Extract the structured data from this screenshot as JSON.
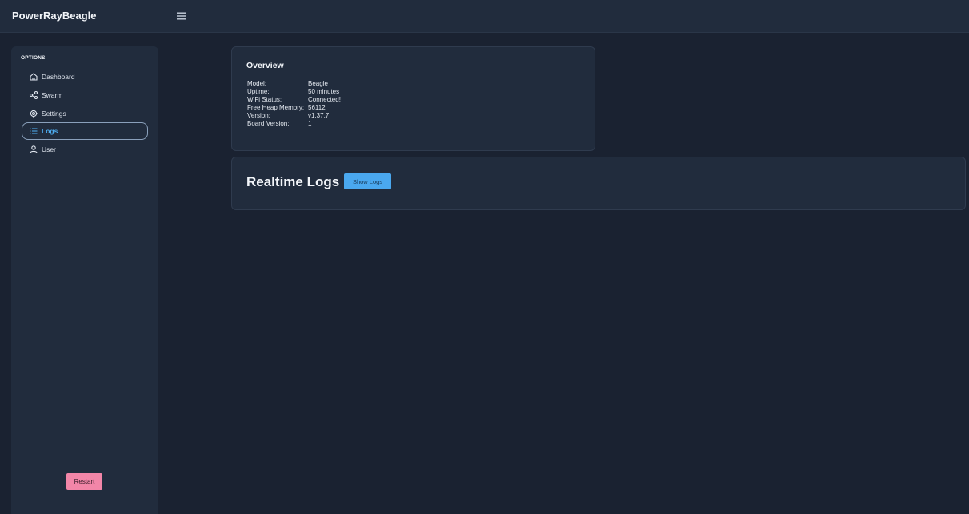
{
  "app": {
    "title": "PowerRayBeagle"
  },
  "topbar": {
    "menu_icon": "hamburger-menu-icon"
  },
  "sidebar": {
    "section_label": "OPTIONS",
    "items": [
      {
        "label": "Dashboard",
        "icon": "home-icon",
        "active": false
      },
      {
        "label": "Swarm",
        "icon": "share-icon",
        "active": false
      },
      {
        "label": "Settings",
        "icon": "gear-icon",
        "active": false
      },
      {
        "label": "Logs",
        "icon": "list-icon",
        "active": true
      },
      {
        "label": "User",
        "icon": "user-icon",
        "active": false
      }
    ],
    "restart_label": "Restart"
  },
  "overview": {
    "title": "Overview",
    "rows": [
      {
        "key": "Model:",
        "value": "Beagle"
      },
      {
        "key": "Uptime:",
        "value": "50 minutes"
      },
      {
        "key": "WiFi Status:",
        "value": "Connected!"
      },
      {
        "key": "Free Heap Memory:",
        "value": "56112"
      },
      {
        "key": "Version:",
        "value": "v1.37.7"
      },
      {
        "key": "Board Version:",
        "value": "1"
      }
    ]
  },
  "logs": {
    "title": "Realtime Logs",
    "button_label": "Show Logs"
  },
  "colors": {
    "page_bg": "#1a2231",
    "panel_bg": "#212c3d",
    "accent_blue": "#4aa8ef",
    "active_text": "#4fb0f5",
    "restart_pink": "#f286a8"
  }
}
